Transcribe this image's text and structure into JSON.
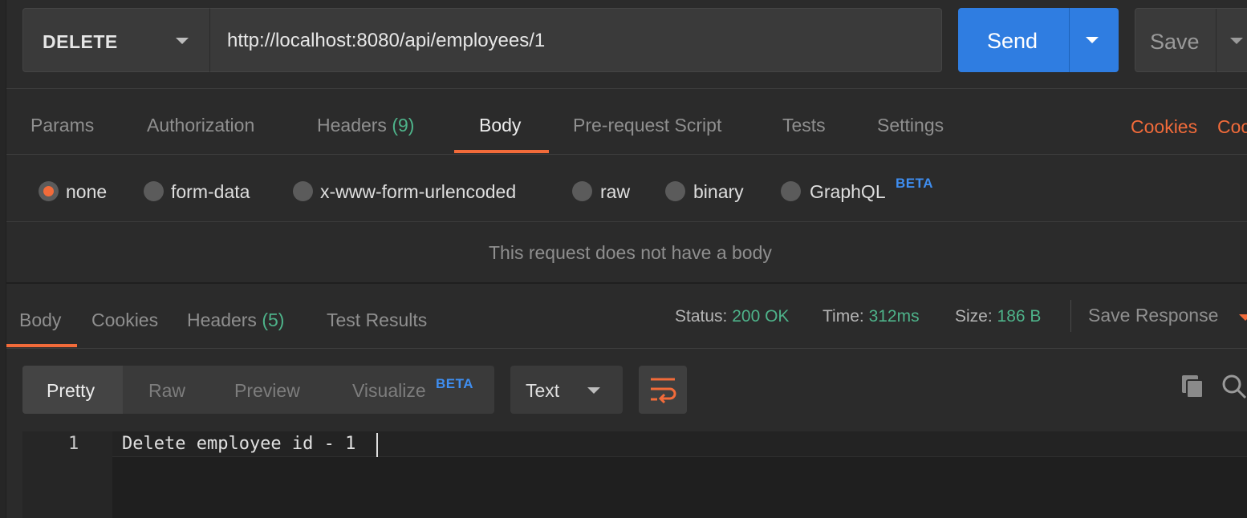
{
  "request": {
    "method": "DELETE",
    "url": "http://localhost:8080/api/employees/1",
    "send_label": "Send",
    "save_label": "Save"
  },
  "request_tabs": [
    {
      "label": "Params"
    },
    {
      "label": "Authorization"
    },
    {
      "label": "Headers",
      "count": "(9)"
    },
    {
      "label": "Body",
      "active": true
    },
    {
      "label": "Pre-request Script"
    },
    {
      "label": "Tests"
    },
    {
      "label": "Settings"
    }
  ],
  "right_links": {
    "cookies": "Cookies",
    "code": "Coc"
  },
  "body_types": [
    {
      "label": "none",
      "selected": true
    },
    {
      "label": "form-data"
    },
    {
      "label": "x-www-form-urlencoded"
    },
    {
      "label": "raw"
    },
    {
      "label": "binary"
    },
    {
      "label": "GraphQL",
      "badge": "BETA"
    }
  ],
  "empty_body_message": "This request does not have a body",
  "response_tabs": [
    {
      "label": "Body",
      "active": true
    },
    {
      "label": "Cookies"
    },
    {
      "label": "Headers",
      "count": "(5)"
    },
    {
      "label": "Test Results"
    }
  ],
  "response_meta": {
    "status_label": "Status:",
    "status_value": "200 OK",
    "time_label": "Time:",
    "time_value": "312ms",
    "size_label": "Size:",
    "size_value": "186 B",
    "save_response": "Save Response"
  },
  "view_modes": [
    {
      "label": "Pretty",
      "active": true
    },
    {
      "label": "Raw"
    },
    {
      "label": "Preview"
    },
    {
      "label": "Visualize",
      "badge": "BETA"
    }
  ],
  "format_select": "Text",
  "editor": {
    "lines": [
      {
        "number": "1",
        "text": "Delete employee id - 1"
      }
    ]
  },
  "colors": {
    "accent_orange": "#f26b3a",
    "send_blue": "#2f7de1",
    "success_green": "#4eb38a",
    "beta_blue": "#3f8ef0"
  }
}
